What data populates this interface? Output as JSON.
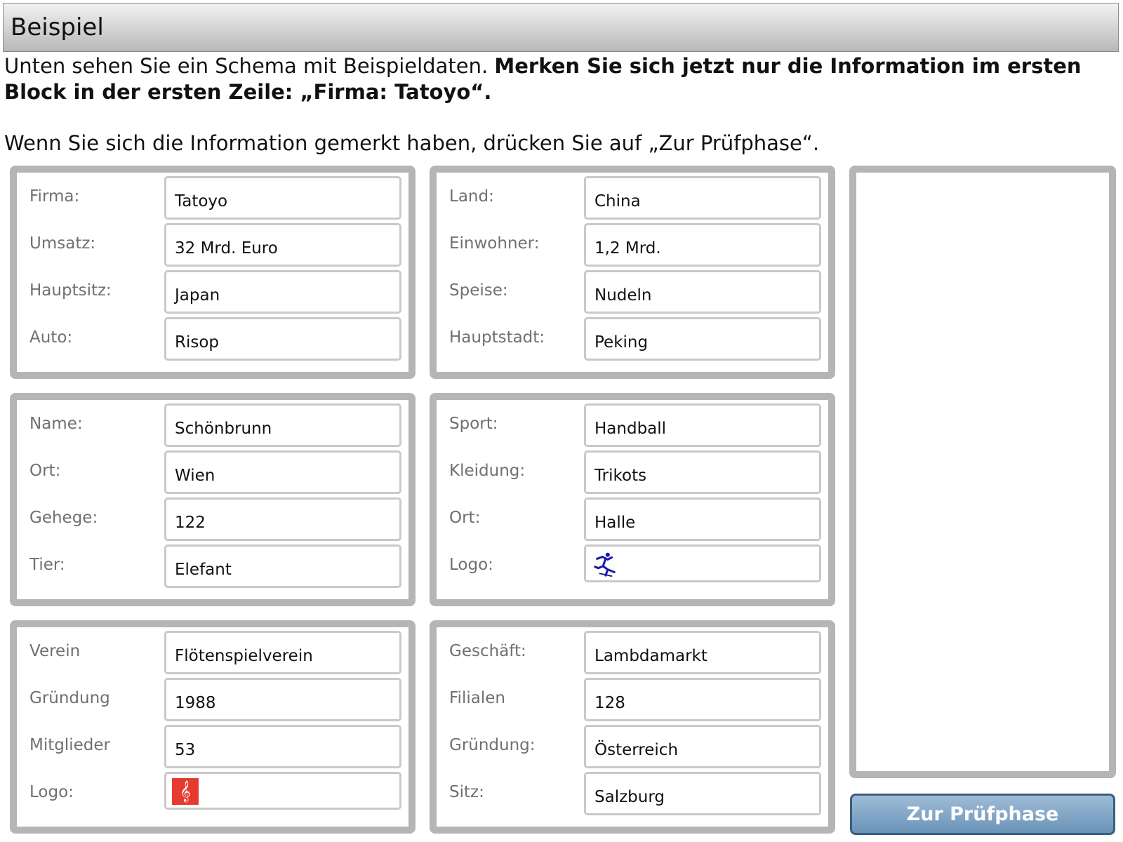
{
  "header": {
    "title": "Beispiel"
  },
  "instructions": {
    "line1_normal": "Unten sehen Sie ein Schema mit Beispieldaten. ",
    "line1_bold": "Merken Sie sich jetzt nur die Information im ersten Block in der ersten Zeile: „Firma: Tatoyo“.",
    "line2": "Wenn Sie sich die Information gemerkt haben, drücken Sie auf „Zur Prüfphase“."
  },
  "blocks": [
    {
      "rows": [
        {
          "label": "Firma:",
          "value": "Tatoyo"
        },
        {
          "label": "Umsatz:",
          "value": "32 Mrd. Euro"
        },
        {
          "label": "Hauptsitz:",
          "value": "Japan"
        },
        {
          "label": "Auto:",
          "value": "Risop"
        }
      ]
    },
    {
      "rows": [
        {
          "label": "Land:",
          "value": "China"
        },
        {
          "label": "Einwohner:",
          "value": "1,2 Mrd."
        },
        {
          "label": "Speise:",
          "value": "Nudeln"
        },
        {
          "label": "Hauptstadt:",
          "value": "Peking"
        }
      ]
    },
    {
      "rows": [
        {
          "label": "Name:",
          "value": "Schönbrunn"
        },
        {
          "label": "Ort:",
          "value": "Wien"
        },
        {
          "label": "Gehege:",
          "value": "122"
        },
        {
          "label": "Tier:",
          "value": "Elefant"
        }
      ]
    },
    {
      "rows": [
        {
          "label": "Sport:",
          "value": "Handball"
        },
        {
          "label": "Kleidung:",
          "value": "Trikots"
        },
        {
          "label": "Ort:",
          "value": "Halle"
        },
        {
          "label": "Logo:",
          "value": "",
          "icon": "running-figure-icon"
        }
      ]
    },
    {
      "rows": [
        {
          "label": "Verein",
          "value": "Flötenspielverein"
        },
        {
          "label": "Gründung",
          "value": "1988"
        },
        {
          "label": "Mitglieder",
          "value": "53"
        },
        {
          "label": "Logo:",
          "value": "",
          "icon": "treble-clef-icon"
        }
      ]
    },
    {
      "rows": [
        {
          "label": "Geschäft:",
          "value": "Lambdamarkt"
        },
        {
          "label": "Filialen",
          "value": "128"
        },
        {
          "label": "Gründung:",
          "value": "Österreich"
        },
        {
          "label": "Sitz:",
          "value": "Salzburg"
        }
      ]
    }
  ],
  "button": {
    "label": "Zur Prüfphase"
  },
  "colors": {
    "runner_icon": "#1a1aa8",
    "clef_bg": "#e53b2f",
    "button": "#7fa3c4"
  }
}
